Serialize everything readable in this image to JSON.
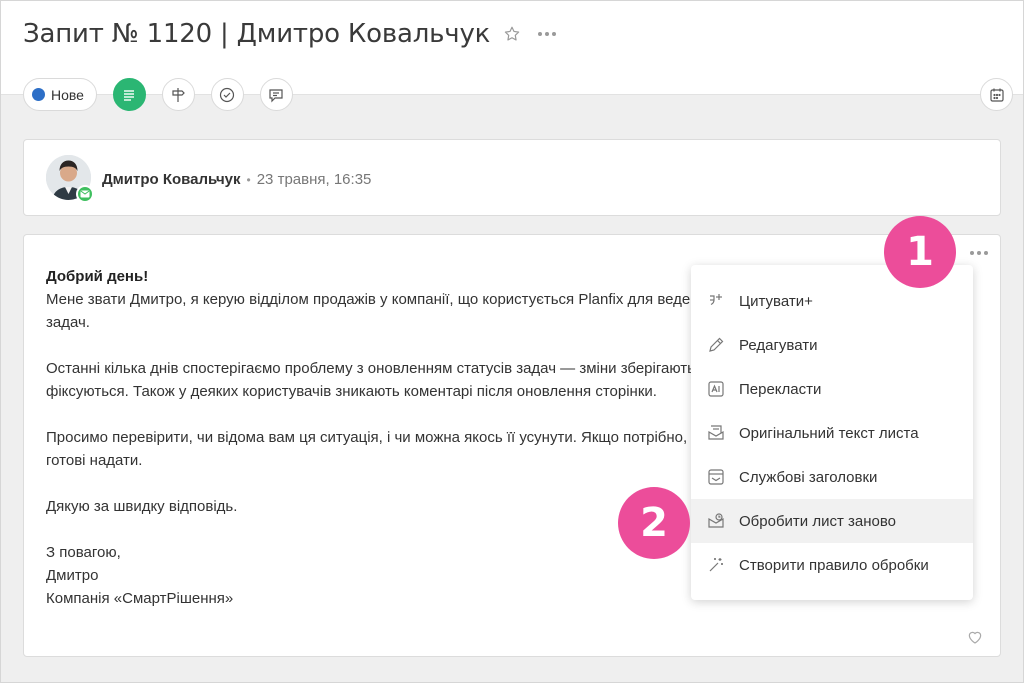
{
  "header": {
    "title": "Запит № 1120 | Дмитро Ковальчук"
  },
  "toolbar": {
    "status_label": "Нове",
    "status_color": "#2d6fc7",
    "icons": [
      "list-icon",
      "signpost-icon",
      "check-circle-icon",
      "comment-icon",
      "calendar-icon"
    ]
  },
  "author": {
    "name": "Дмитро Ковальчук",
    "separator": "•",
    "date": "23 травня, 16:35"
  },
  "message": {
    "greeting": "Добрий день!",
    "line1": "Мене звати Дмитро, я керую відділом продажів у компанії, що користується Planfix для ведення",
    "line2": "задач.",
    "line3": "Останні кілька днів спостерігаємо проблему з оновленням статусів задач — зміни зберігаються, але не",
    "line4": "фіксуються. Також у деяких користувачів зникають коментарі після оновлення сторінки.",
    "line5": "Просимо перевірити, чи відома вам ця ситуація, і чи можна якось її усунути. Якщо потрібно, деталі",
    "line6": "готові надати.",
    "line7": "Дякую за швидку відповідь.",
    "sign1": "З повагою,",
    "sign2": "Дмитро",
    "sign3": "Компанія «СмартРішення»"
  },
  "menu": {
    "items": [
      {
        "label": "Цитувати+",
        "icon": "quote-plus-icon"
      },
      {
        "label": "Редагувати",
        "icon": "pencil-icon"
      },
      {
        "label": "Перекласти",
        "icon": "translate-icon"
      },
      {
        "label": "Оригінальний текст листа",
        "icon": "original-mail-icon"
      },
      {
        "label": "Службові заголовки",
        "icon": "mail-headers-icon"
      },
      {
        "label": "Обробити лист заново",
        "icon": "reprocess-mail-icon"
      },
      {
        "label": "Створити правило обробки",
        "icon": "magic-wand-icon"
      }
    ]
  },
  "callouts": {
    "first": "1",
    "second": "2",
    "color": "#ec4d9a"
  }
}
